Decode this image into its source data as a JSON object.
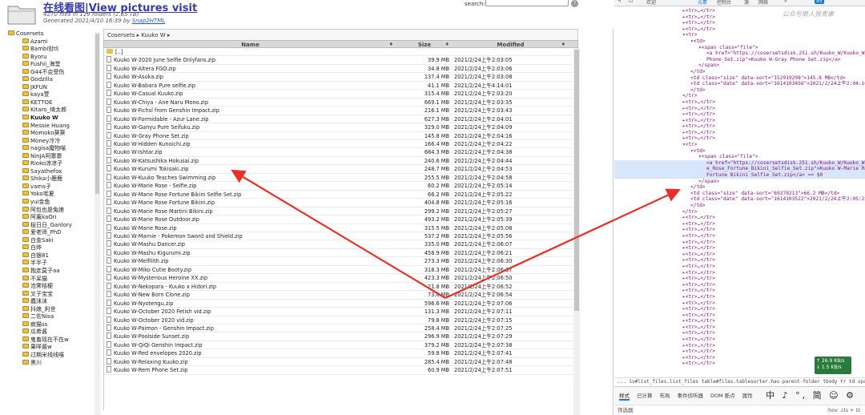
{
  "header": {
    "title": "在线看图|View pictures visit",
    "stats": "4270 files in 119 folders (1.65 TB)",
    "generated_prefix": "Generated 2021/4/10 16:39 by ",
    "generated_link": "Snap2HTML",
    "search_label": "search:",
    "help_icon": "?"
  },
  "tree": [
    {
      "label": "Cosersets",
      "root": true
    },
    {
      "label": "Azami"
    },
    {
      "label": "Bambi밤비"
    },
    {
      "label": "Byoru"
    },
    {
      "label": "Fushii_海堂"
    },
    {
      "label": "G44不会受伤"
    },
    {
      "label": "Godzilla"
    },
    {
      "label": "JKFUN"
    },
    {
      "label": "kaya萱"
    },
    {
      "label": "KETTOE"
    },
    {
      "label": "Kitaro_绮太郎"
    },
    {
      "label": "Kuuko W",
      "active": true
    },
    {
      "label": "Messie Huang"
    },
    {
      "label": "Momoko葵葵"
    },
    {
      "label": "Money冷冷"
    },
    {
      "label": "nagisa魔物喵"
    },
    {
      "label": "NinJA阿寨寨"
    },
    {
      "label": "Rioko凉凉子"
    },
    {
      "label": "Sayathefox"
    },
    {
      "label": "Shika小鹿鹿"
    },
    {
      "label": "vams子"
    },
    {
      "label": "Yoko宅夏"
    },
    {
      "label": "yui金鱼"
    },
    {
      "label": "阿包也是兔娘"
    },
    {
      "label": "阿薰kaOri"
    },
    {
      "label": "桜日日_Ganlory"
    },
    {
      "label": "爱老师_PhD"
    },
    {
      "label": "白金Saki"
    },
    {
      "label": "白烨"
    },
    {
      "label": "白银81"
    },
    {
      "label": "半半子"
    },
    {
      "label": "抱走莫子aa"
    },
    {
      "label": "不呆猫"
    },
    {
      "label": "沧霁桔梗"
    },
    {
      "label": "叉子宝宝"
    },
    {
      "label": "蠢沫沫"
    },
    {
      "label": "抖娘_利世"
    },
    {
      "label": "二佐Nisa"
    },
    {
      "label": "疯猫ss"
    },
    {
      "label": "瓜希酱"
    },
    {
      "label": "鬼畜瑶在不在w"
    },
    {
      "label": "果咩酱w"
    },
    {
      "label": "过期米线线喵"
    },
    {
      "label": "黑川"
    }
  ],
  "panel": {
    "breadcrumb": "Cosersets ▸ Kuuko W ▸",
    "columns": {
      "name": "Name",
      "size": "Size",
      "modified": "Modified"
    },
    "sort_icon": "♦",
    "parent_row": "[..]",
    "files": [
      [
        "Kuuko W-2020 June Selfie Onlyfans.zip",
        "39.9 MB",
        "2021/2/24上午2:03:05"
      ],
      [
        "Kuuko W-Altera FGO.zip",
        "34.8 MB",
        "2021/2/24上午2:03:06"
      ],
      [
        "Kuuko W-Asuka.zip",
        "137.4 MB",
        "2021/2/24上午2:03:08"
      ],
      [
        "Kuuko W-Babara Pure selfie.zip",
        "41.1 MB",
        "2021/2/24上午4:14:01"
      ],
      [
        "Kuuko W-Casual Kuuko.zip",
        "315.4 MB",
        "2021/2/24上午2:03:20"
      ],
      [
        "Kuuko W-Chiya - Ane Naru Mono.zip",
        "669.1 MB",
        "2021/2/24上午2:03:35"
      ],
      [
        "Kuuko W-Fichsl from Genshin Impact.zip",
        "216.1 MB",
        "2021/2/24上午2:03:43"
      ],
      [
        "Kuuko W-Formidable - Azur Lane.zip",
        "627.3 MB",
        "2021/2/24上午2:04:01"
      ],
      [
        "Kuuko W-Ganyu Pure Seifuku.zip",
        "329.0 MB",
        "2021/2/24上午2:04:09"
      ],
      [
        "Kuuko W-Gray Phone Set.zip",
        "145.8 MB",
        "2021/2/24上午2:04:16"
      ],
      [
        "Kuuko W-Hidden Kunoichi.zip",
        "166.4 MB",
        "2021/2/24上午2:04:22"
      ],
      [
        "Kuuko W-Ishtar.zip",
        "684.3 MB",
        "2021/2/24上午2:04:38"
      ],
      [
        "Kuuko W-Katsushika Hokusai.zip",
        "240.6 MB",
        "2021/2/24上午2:04:44"
      ],
      [
        "Kuuko W-Kurumi Tokisaki.zip",
        "248.7 MB",
        "2021/2/24上午2:04:53"
      ],
      [
        "Kuuko W-Kuuko Teaches Swimming.zip",
        "255.5 MB",
        "2021/2/24上午2:04:58"
      ],
      [
        "Kuuko W-Marie Rose - Selfie.zip",
        "60.2 MB",
        "2021/2/24上午2:05:14"
      ],
      [
        "Kuuko W-Marie Rose Fortune Bikini Selfie Set.zip",
        "66.2 MB",
        "2021/2/24上午2:05:22"
      ],
      [
        "Kuuko W-Marie Rose Fortune Bikini.zip",
        "404.8 MB",
        "2021/2/24上午2:05:16"
      ],
      [
        "Kuuko W-Marie Rose Martini Bikini.zip",
        "299.2 MB",
        "2021/2/24上午2:05:27"
      ],
      [
        "Kuuko W-Marie Rose Outdoor.zip",
        "493.2 MB",
        "2021/2/24上午2:05:39"
      ],
      [
        "Kuuko W-Marie Rose.zip",
        "315.5 MB",
        "2021/2/24上午2:05:08"
      ],
      [
        "Kuuko W-Marnie - Pokemon Sword and Shield.zip",
        "537.2 MB",
        "2021/2/24上午2:05:56"
      ],
      [
        "Kuuko W-Mashu Dancer.zip",
        "335.0 MB",
        "2021/2/24上午2:06:07"
      ],
      [
        "Kuuko W-Mashu Kigurumi.zip",
        "458.9 MB",
        "2021/2/24上午2:06:21"
      ],
      [
        "Kuuko W-Melfilith.zip",
        "273.3 MB",
        "2021/2/24上午2:06:30"
      ],
      [
        "Kuuko W-Miko Cutie Booty.zip",
        "318.3 MB",
        "2021/2/24上午2:06:37"
      ],
      [
        "Kuuko W-Mysterious Heroine XX.zip",
        "423.3 MB",
        "2021/2/24上午2:06:50"
      ],
      [
        "Kuuko W-Nekopara - Kuuko x Hidori.zip",
        "21.8 MB",
        "2021/2/24上午2:06:52"
      ],
      [
        "Kuuko W-New Born Clone.zip",
        "73.0 MB",
        "2021/2/24上午2:06:54"
      ],
      [
        "Kuuko W-Nyotengu.zip",
        "596.6 MB",
        "2021/2/24上午2:07:06"
      ],
      [
        "Kuuko W-October 2020 Fetish vid.zip",
        "131.3 MB",
        "2021/2/24上午2:07:11"
      ],
      [
        "Kuuko W-October 2020 vid.zip",
        "79.8 MB",
        "2021/2/24上午2:07:15"
      ],
      [
        "Kuuko W-Paimon - Genshin Impact.zip",
        "258.4 MB",
        "2021/2/24上午2:07:25"
      ],
      [
        "Kuuko W-Poolside Sunset.zip",
        "296.9 MB",
        "2021/2/24上午2:07:29"
      ],
      [
        "Kuuko W-QiQi Genshin Impact.zip",
        "379.2 MB",
        "2021/2/24上午2:07:38"
      ],
      [
        "Kuuko W-Red envelopes 2020.zip",
        "59.8 MB",
        "2021/2/24上午2:07:41"
      ],
      [
        "Kuuko W-Relaxing Kuuko.zip",
        "285.4 MB",
        "2021/2/24上午2:07:48"
      ],
      [
        "Kuuko W-Rem Phone Set.zip",
        "60.9 MB",
        "2021/2/24上午2:07:51"
      ]
    ]
  },
  "devtools": {
    "tabs": [
      "Ч",
      "⊡",
      "欢迎",
      "元素",
      "控制台",
      "源",
      "网络",
      "»"
    ],
    "error_count": "95",
    "watermark": "公众号概人我贵康",
    "dom_lines": [
      {
        "i": 6,
        "t": "▸<tr>…</tr>"
      },
      {
        "i": 6,
        "t": "▸<tr>…</tr>"
      },
      {
        "i": 6,
        "t": "▸<tr>…</tr>"
      },
      {
        "i": 6,
        "t": "▸<tr>…</tr>"
      },
      {
        "i": 6,
        "t": "▾<tr>"
      },
      {
        "i": 8,
        "t": "▾<td>"
      },
      {
        "i": 10,
        "t": "▾<span class=\"file\">"
      },
      {
        "i": 12,
        "t": "<a href=\"https://cosersetsdisk.251.sh/Kuuko_W/Kuuko_W-Gray_"
      },
      {
        "i": 12,
        "t": "Phone_Set.zip\">Kuuko W-Gray Phone Set.zip</a>"
      },
      {
        "i": 10,
        "t": "</span>"
      },
      {
        "i": 8,
        "t": "</td>"
      },
      {
        "i": 8,
        "t": "<td class=\"size\" data-sort=\"152919298\">145.8 MB</td>"
      },
      {
        "i": 8,
        "t": "<td class=\"date\" data-sort=\"1614103456\">2021/2/24上午2:04:16"
      },
      {
        "i": 8,
        "t": "</td>"
      },
      {
        "i": 6,
        "t": "</tr>"
      },
      {
        "i": 6,
        "t": "▸<tr>…</tr>"
      },
      {
        "i": 6,
        "t": "▸<tr>…</tr>"
      },
      {
        "i": 6,
        "t": "▸<tr>…</tr>"
      },
      {
        "i": 6,
        "t": "▸<tr>…</tr>"
      },
      {
        "i": 6,
        "t": "▸<tr>…</tr>"
      },
      {
        "i": 6,
        "t": "▸<tr>…</tr>"
      },
      {
        "i": 6,
        "t": "▸<tr>…</tr>"
      },
      {
        "i": 6,
        "t": "▾<tr>"
      },
      {
        "i": 8,
        "t": "▾<td>"
      },
      {
        "i": 10,
        "t": "▾<span class=\"file\">"
      },
      {
        "i": 12,
        "t": "<a href=\"https://cosersetsdisk.251.sh/Kuuko_W/Kuuko_W-Mari",
        "sel": true
      },
      {
        "i": 12,
        "t": "e_Rose_Fortune_Bikini_Selfie_Set.zip\">Kuuko W-Marie Rose",
        "sel": true
      },
      {
        "i": 12,
        "t": "Fortune Bikini Selfie Set.zip</a> == $0",
        "sel": true
      },
      {
        "i": 10,
        "t": "</span>"
      },
      {
        "i": 8,
        "t": "</td>"
      },
      {
        "i": 8,
        "t": "<td class=\"size\" data-sort=\"69370213\">66.2 MB</td>"
      },
      {
        "i": 8,
        "t": "<td class=\"date\" data-sort=\"1614103522\">2021/2/24上午2:05:22"
      },
      {
        "i": 8,
        "t": "</td>"
      },
      {
        "i": 6,
        "t": "</tr>"
      },
      {
        "i": 6,
        "t": "▸<tr>…</tr>"
      },
      {
        "i": 6,
        "t": "▸<tr>…</tr>"
      },
      {
        "i": 6,
        "t": "▸<tr>…</tr>"
      },
      {
        "i": 6,
        "t": "▸<tr>…</tr>"
      },
      {
        "i": 6,
        "t": "▸<tr>…</tr>"
      },
      {
        "i": 6,
        "t": "▸<tr>…</tr>"
      },
      {
        "i": 6,
        "t": "▸<tr>…</tr>"
      },
      {
        "i": 6,
        "t": "▸<tr>…</tr>"
      },
      {
        "i": 6,
        "t": "▸<tr>…</tr>"
      },
      {
        "i": 6,
        "t": "▸<tr>…</tr>"
      },
      {
        "i": 6,
        "t": "▸<tr>…</tr>"
      },
      {
        "i": 6,
        "t": "▸<tr>…</tr>"
      },
      {
        "i": 6,
        "t": "▸<tr>…</tr>"
      },
      {
        "i": 6,
        "t": "▸<tr>…</tr>"
      },
      {
        "i": 6,
        "t": "▸<tr>…</tr>"
      },
      {
        "i": 6,
        "t": "▸<tr>…</tr>"
      },
      {
        "i": 6,
        "t": "▸<tr>…</tr>"
      },
      {
        "i": 6,
        "t": "▸<tr>…</tr>"
      },
      {
        "i": 6,
        "t": "▸<tr>…</tr>"
      },
      {
        "i": 6,
        "t": "▸<tr>…</tr>"
      },
      {
        "i": 6,
        "t": "▸<tr>…</tr>"
      },
      {
        "i": 6,
        "t": "▸<tr>…</tr>"
      },
      {
        "i": 6,
        "t": "▸<tr>…</tr>"
      },
      {
        "i": 6,
        "t": "▸<tr>…</tr>"
      },
      {
        "i": 6,
        "t": "▸<tr>…</tr>"
      }
    ],
    "net_up": "↑ 26.9 KB/s",
    "net_down": "↓ 1.5 KB/s",
    "crumbs_prefix": "... iv#list_files.list_files  table#files.tablesorter.has-parent-folder  tbody  tr  td  span.file  a",
    "style_tabs": [
      "样式",
      "已计算",
      "布局",
      "事件侦听器",
      "DOM 断点",
      "属性"
    ],
    "ime": "中 ♪ °, 简 ☺ ⚙",
    "filter_label": "筛选器",
    "filter_right": ":hov  .cls  +  ⊡"
  },
  "colors": {
    "arrow": "#e8302a",
    "title": "#3a3aa8",
    "header_bg": "#d9d9d9"
  }
}
